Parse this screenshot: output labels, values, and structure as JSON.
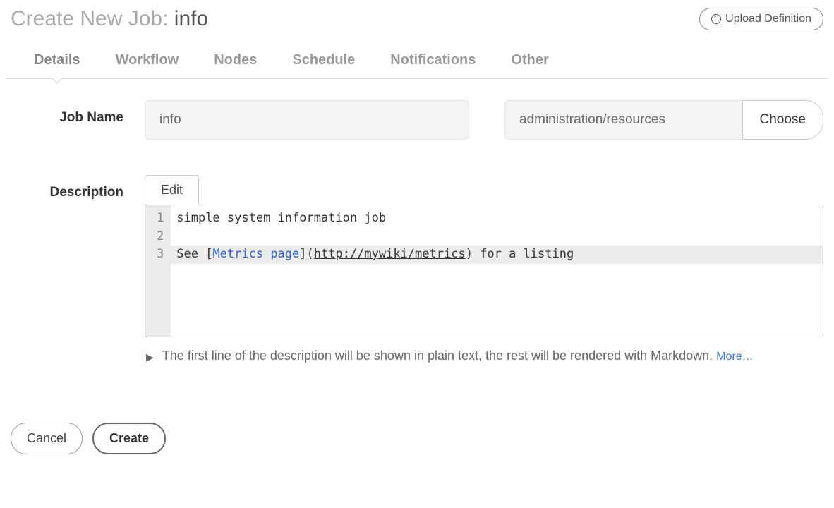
{
  "header": {
    "title_prefix": "Create New Job: ",
    "title_value": "info",
    "upload_label": "Upload Definition"
  },
  "tabs": {
    "details": "Details",
    "workflow": "Workflow",
    "nodes": "Nodes",
    "schedule": "Schedule",
    "notifications": "Notifications",
    "other": "Other",
    "active": "details"
  },
  "form": {
    "job_name_label": "Job Name",
    "job_name_value": "info",
    "group_value": "administration/resources",
    "choose_label": "Choose",
    "description_label": "Description",
    "edit_tab_label": "Edit",
    "editor_lines": {
      "num1": "1",
      "num2": "2",
      "num3": "3",
      "line1": "simple system information job",
      "line2": "",
      "line3_prefix": "See [",
      "line3_linktext": "Metrics page",
      "line3_mid": "](",
      "line3_url": "http://mywiki/metrics",
      "line3_suffix": ") for a listing"
    },
    "hint_text": "The first line of the description will be shown in plain text, the rest will be rendered with Markdown. ",
    "more_label": "More…"
  },
  "footer": {
    "cancel": "Cancel",
    "create": "Create"
  }
}
